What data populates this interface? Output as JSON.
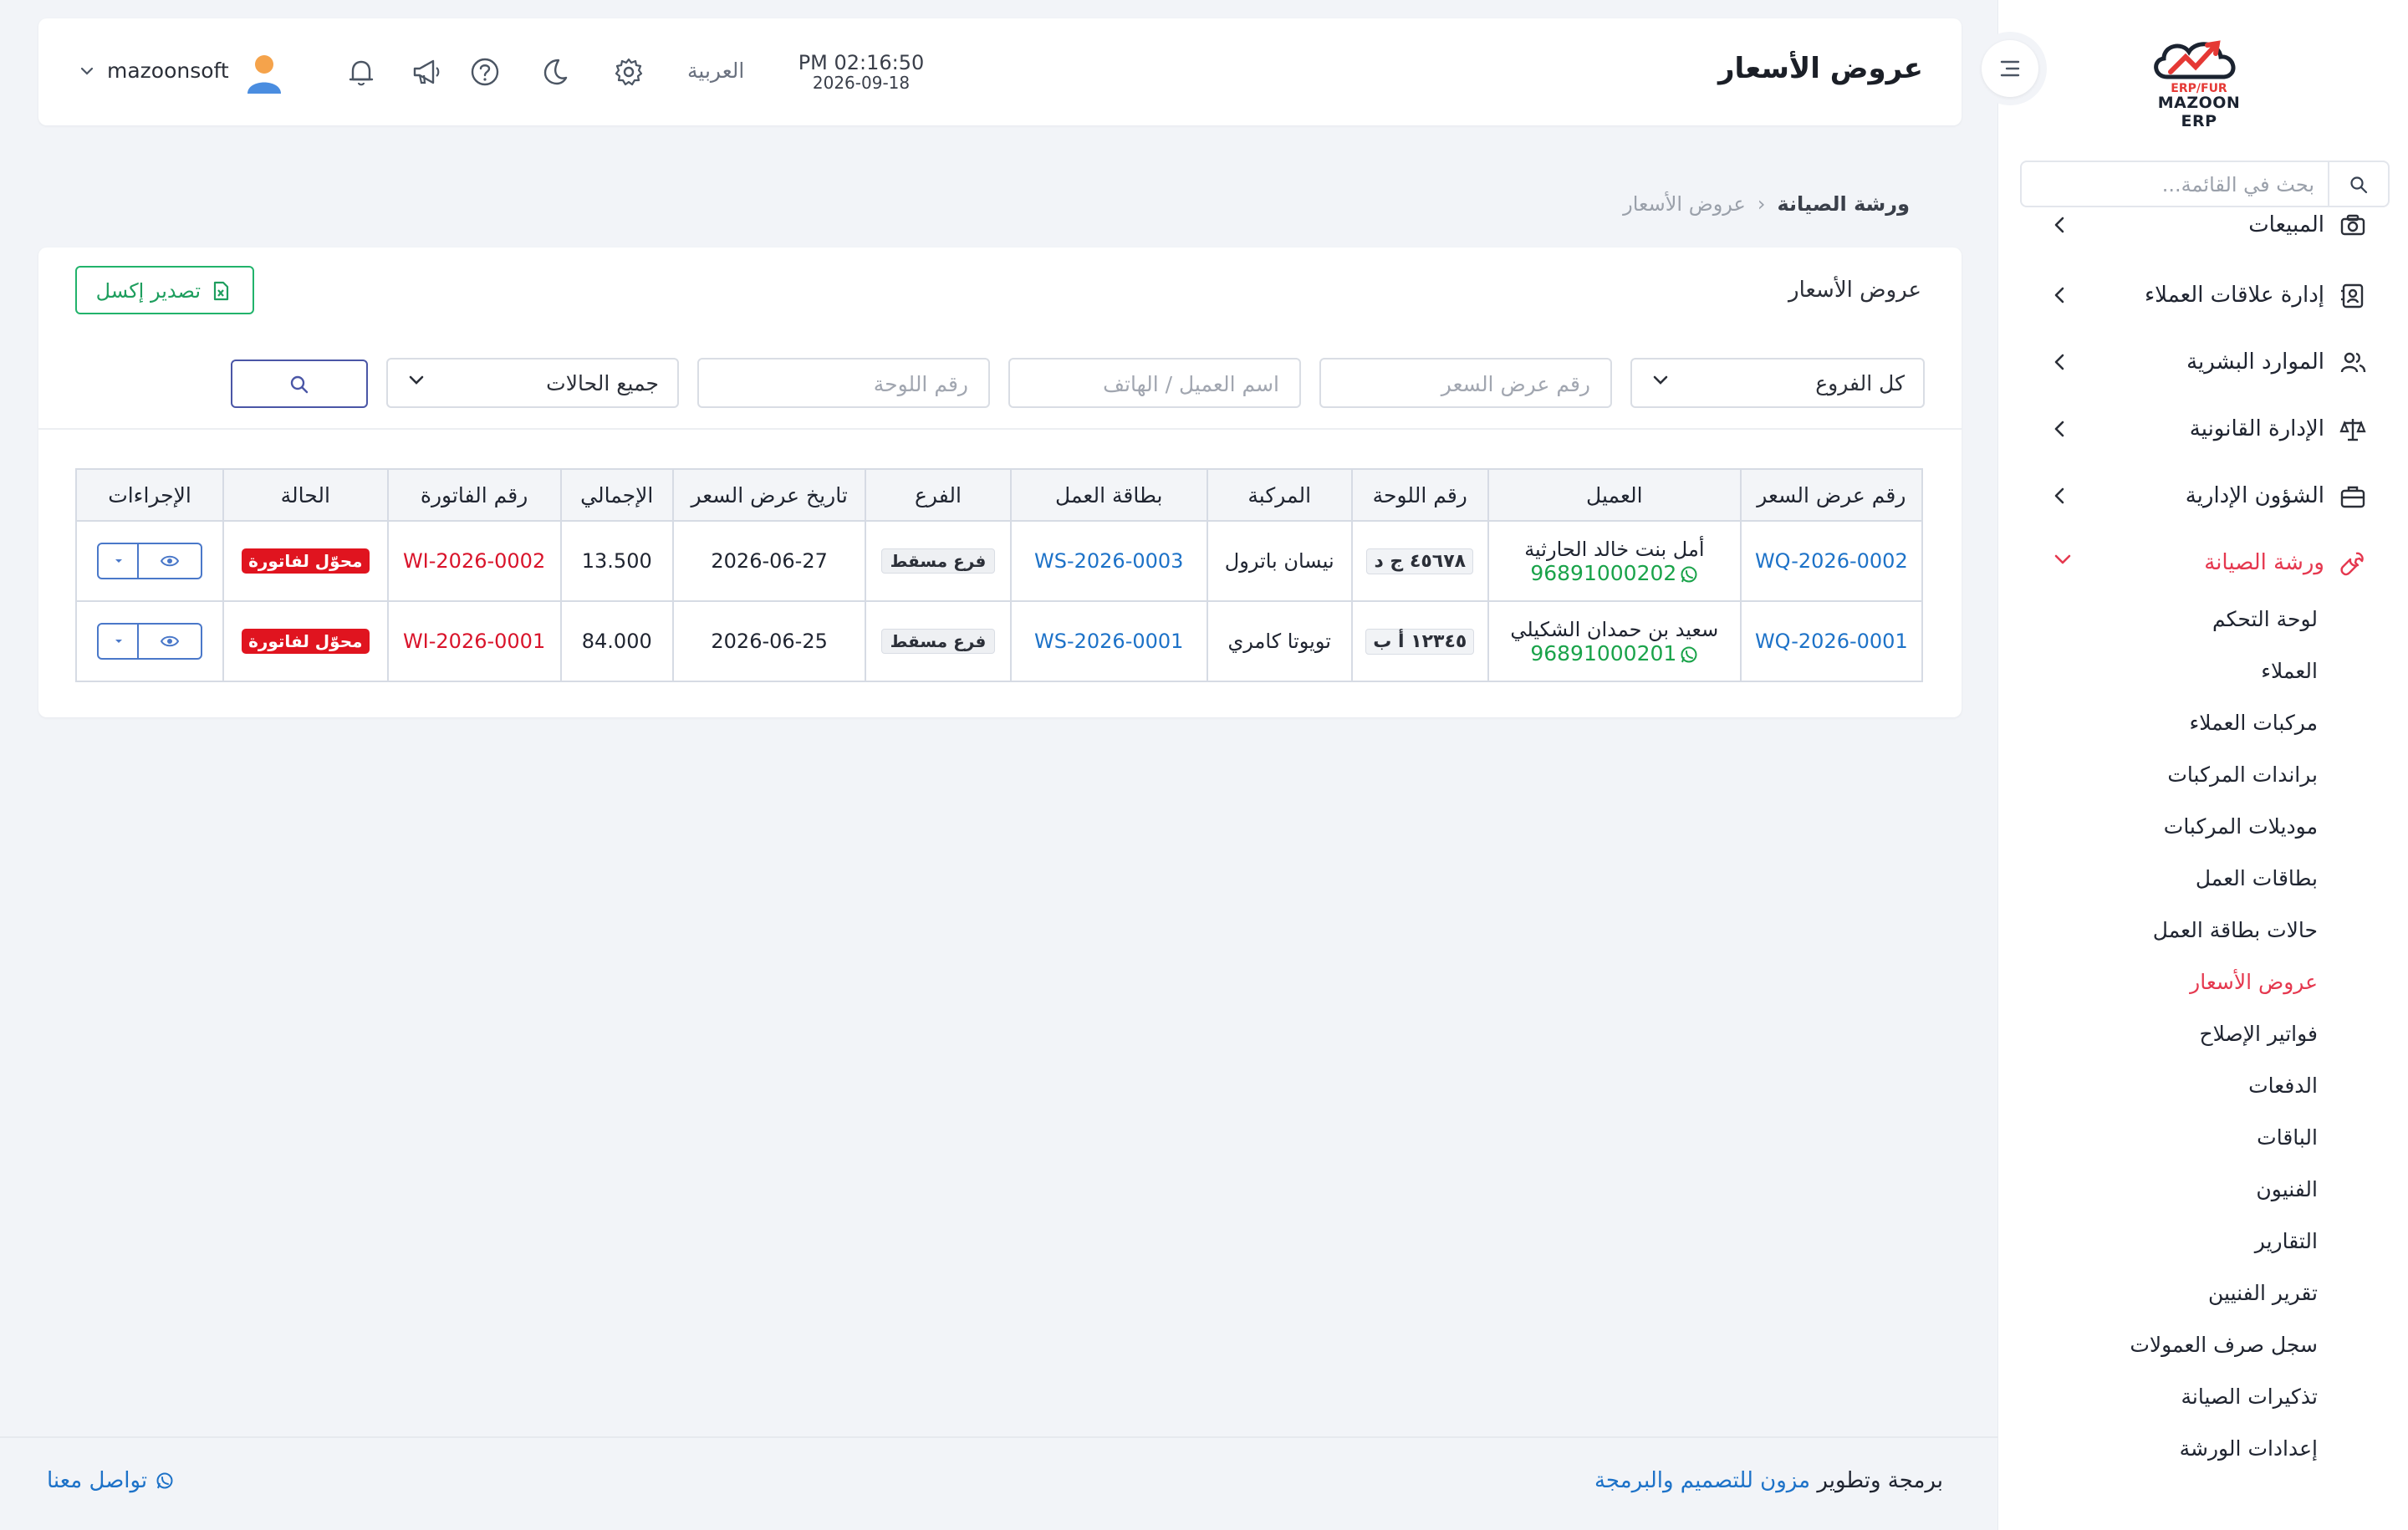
{
  "app": {
    "logo_text": "MAZOON ERP",
    "logo_small": "ERP/FUR",
    "page_title": "عروض الأسعار",
    "clock_time": "PM 02:16:50",
    "clock_date": "2026-09-18",
    "language": "العربية",
    "username": "mazoonsoft",
    "accent_color": "#e5384f"
  },
  "sidebar": {
    "search_placeholder": "بحث في القائمة...",
    "menu": [
      {
        "label": "المبيعات",
        "icon": "camera-icon"
      },
      {
        "label": "إدارة علاقات العملاء",
        "icon": "contact-card-icon"
      },
      {
        "label": "الموارد البشرية",
        "icon": "users-icon"
      },
      {
        "label": "الإدارة القانونية",
        "icon": "scale-icon"
      },
      {
        "label": "الشؤون الإدارية",
        "icon": "briefcase-icon"
      },
      {
        "label": "ورشة الصيانة",
        "icon": "wrench-icon"
      }
    ],
    "submenu": [
      {
        "label": "لوحة التحكم"
      },
      {
        "label": "العملاء"
      },
      {
        "label": "مركبات العملاء"
      },
      {
        "label": "براندات المركبات"
      },
      {
        "label": "موديلات المركبات"
      },
      {
        "label": "بطاقات العمل"
      },
      {
        "label": "حالات بطاقة العمل"
      },
      {
        "label": "عروض الأسعار"
      },
      {
        "label": "فواتير الإصلاح"
      },
      {
        "label": "الدفعات"
      },
      {
        "label": "الباقات"
      },
      {
        "label": "الفنيون"
      },
      {
        "label": "التقارير"
      },
      {
        "label": "تقرير الفنيين"
      },
      {
        "label": "سجل صرف العمولات"
      },
      {
        "label": "تذكيرات الصيانة"
      },
      {
        "label": "إعدادات الورشة"
      }
    ]
  },
  "breadcrumb": {
    "parent": "ورشة الصيانة",
    "separator": "‹",
    "current": "عروض الأسعار"
  },
  "card": {
    "title": "عروض الأسعار",
    "export_label": "تصدير إكسل",
    "filters": {
      "branch": "كل الفروع",
      "quote_placeholder": "رقم عرض السعر",
      "customer_placeholder": "اسم العميل / الهاتف",
      "plate_placeholder": "رقم اللوحة",
      "status": "جميع الحالات"
    }
  },
  "table": {
    "headers": {
      "quote_no": "رقم عرض السعر",
      "customer": "العميل",
      "plate": "رقم اللوحة",
      "vehicle": "المركبة",
      "job_card": "بطاقة العمل",
      "branch": "الفرع",
      "date": "تاريخ عرض السعر",
      "total": "الإجمالي",
      "invoice": "رقم الفاتورة",
      "status": "الحالة",
      "actions": "الإجراءات"
    },
    "rows": [
      {
        "quote_no": "WQ-2026-0002",
        "customer": "أمل بنت خالد الحارثية",
        "phone": "96891000202",
        "plate": "٤٥٦٧٨ ج د",
        "vehicle": "نيسان باترول",
        "job_card": "WS-2026-0003",
        "branch": "فرع مسقط",
        "date": "2026-06-27",
        "total": "13.500",
        "invoice": "WI-2026-0002",
        "status": "محوّل لفاتورة"
      },
      {
        "quote_no": "WQ-2026-0001",
        "customer": "سعيد بن حمدان الشكيلي",
        "phone": "96891000201",
        "plate": "١٢٣٤٥ أ ب",
        "vehicle": "تويوتا كامري",
        "job_card": "WS-2026-0001",
        "branch": "فرع مسقط",
        "date": "2026-06-25",
        "total": "84.000",
        "invoice": "WI-2026-0001",
        "status": "محوّل لفاتورة"
      }
    ]
  },
  "footer": {
    "dev_prefix": "برمجة وتطوير",
    "dev_brand": "مزون للتصميم والبرمجة",
    "contact": "تواصل معنا"
  }
}
